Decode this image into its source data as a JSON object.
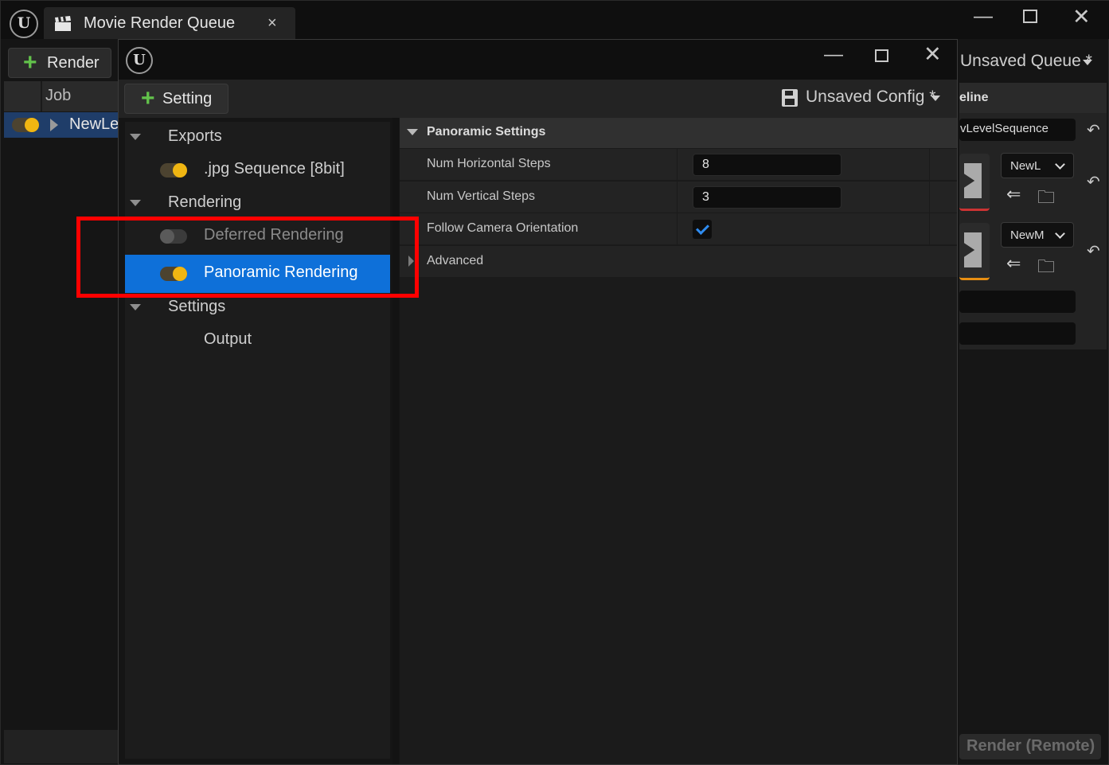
{
  "background_window": {
    "tab_title": "Movie Render Queue",
    "tab_close": "×",
    "controls": {
      "minimize": "—",
      "close": "✕"
    },
    "render_button": {
      "icon": "plus-icon",
      "label": "Render"
    },
    "job_column_header": "Job",
    "job_row": {
      "name": "NewLe",
      "enabled": true
    },
    "queue_dropdown": "Unsaved Queue *",
    "pipeline_header": "eline",
    "sequence_field": "vLevelSequence",
    "rows": [
      {
        "combo": "NewL"
      },
      {
        "combo": "NewM"
      }
    ],
    "render_remote_label": "Render (Remote)"
  },
  "config_window": {
    "controls": {
      "minimize": "—",
      "close": "✕"
    },
    "setting_button": {
      "icon": "plus-icon",
      "label": "Setting"
    },
    "config_dropdown": "Unsaved Config *",
    "tree": {
      "exports": {
        "label": "Exports"
      },
      "jpg": {
        "label": ".jpg Sequence [8bit]",
        "enabled": true
      },
      "rendering": {
        "label": "Rendering"
      },
      "deferred": {
        "label": "Deferred Rendering",
        "enabled": false
      },
      "panoramic": {
        "label": "Panoramic Rendering",
        "enabled": true,
        "selected": true
      },
      "settings": {
        "label": "Settings"
      },
      "output": {
        "label": "Output"
      }
    },
    "details": {
      "section_title": "Panoramic Settings",
      "properties": {
        "horizontal": {
          "name": "Num Horizontal Steps",
          "value": "8"
        },
        "vertical": {
          "name": "Num Vertical Steps",
          "value": "3"
        },
        "follow_camera": {
          "name": "Follow Camera Orientation",
          "checked": true
        },
        "advanced": {
          "name": "Advanced"
        }
      }
    }
  },
  "colors": {
    "selection": "#0e70d9",
    "highlight_box": "#ff0000",
    "toggle_on": "#f0b612",
    "add_icon": "#62c24b",
    "checkmark": "#2f8cf0"
  }
}
